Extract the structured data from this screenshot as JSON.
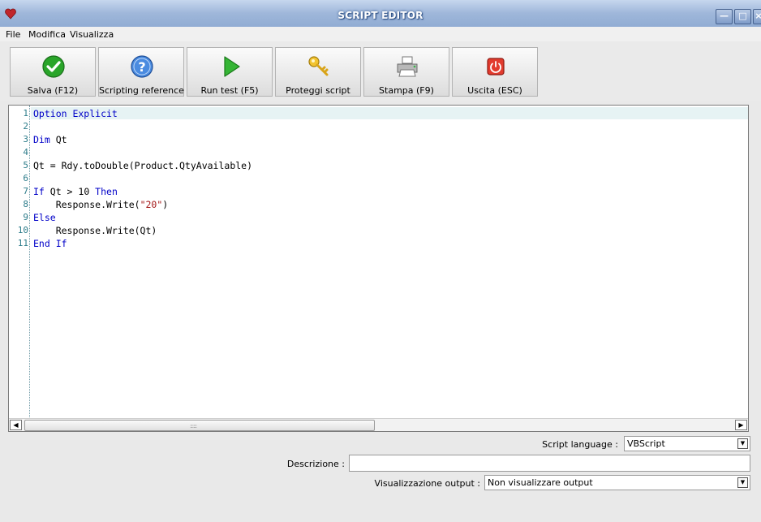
{
  "window": {
    "title": "SCRIPT EDITOR",
    "controls": {
      "minimize": "—",
      "maximize": "□",
      "close": "×"
    }
  },
  "menu": {
    "items": [
      {
        "label": "File"
      },
      {
        "label": "Modifica"
      },
      {
        "label": "Visualizza"
      }
    ]
  },
  "toolbar": {
    "buttons": [
      {
        "label": "Salva (F12)",
        "icon": "check-icon"
      },
      {
        "label": "Scripting reference",
        "icon": "help-icon"
      },
      {
        "label": "Run test (F5)",
        "icon": "play-icon"
      },
      {
        "label": "Proteggi script",
        "icon": "key-icon"
      },
      {
        "label": "Stampa (F9)",
        "icon": "printer-icon"
      },
      {
        "label": "Uscita (ESC)",
        "icon": "power-icon"
      }
    ]
  },
  "editor": {
    "line_numbers": [
      "1",
      "2",
      "3",
      "4",
      "5",
      "6",
      "7",
      "8",
      "9",
      "10",
      "11"
    ],
    "current_line": 1,
    "lines": [
      [
        {
          "t": "Option Explicit",
          "c": "kw"
        }
      ],
      [],
      [
        {
          "t": "Dim",
          "c": "kw"
        },
        {
          "t": " Qt",
          "c": ""
        }
      ],
      [],
      [
        {
          "t": "Qt = Rdy.toDouble(Product.QtyAvailable)",
          "c": ""
        }
      ],
      [],
      [
        {
          "t": "If",
          "c": "kw"
        },
        {
          "t": " Qt > 10 ",
          "c": ""
        },
        {
          "t": "Then",
          "c": "kw"
        }
      ],
      [
        {
          "t": "    Response.Write(",
          "c": ""
        },
        {
          "t": "\"20\"",
          "c": "str"
        },
        {
          "t": ")",
          "c": ""
        }
      ],
      [
        {
          "t": "Else",
          "c": "kw"
        }
      ],
      [
        {
          "t": "    Response.Write(Qt)",
          "c": ""
        }
      ],
      [
        {
          "t": "End If",
          "c": "kw"
        }
      ]
    ],
    "scroll_position": 0.0
  },
  "form": {
    "script_language": {
      "label": "Script language :",
      "value": "VBScript"
    },
    "descrizione": {
      "label": "Descrizione :",
      "value": ""
    },
    "output": {
      "label": "Visualizzazione output :",
      "value": "Non visualizzare output"
    }
  },
  "colors": {
    "keyword": "#0000c8",
    "string": "#a31515",
    "line_number": "#2c7c8a",
    "current_line_bg": "#e6f3f4"
  }
}
